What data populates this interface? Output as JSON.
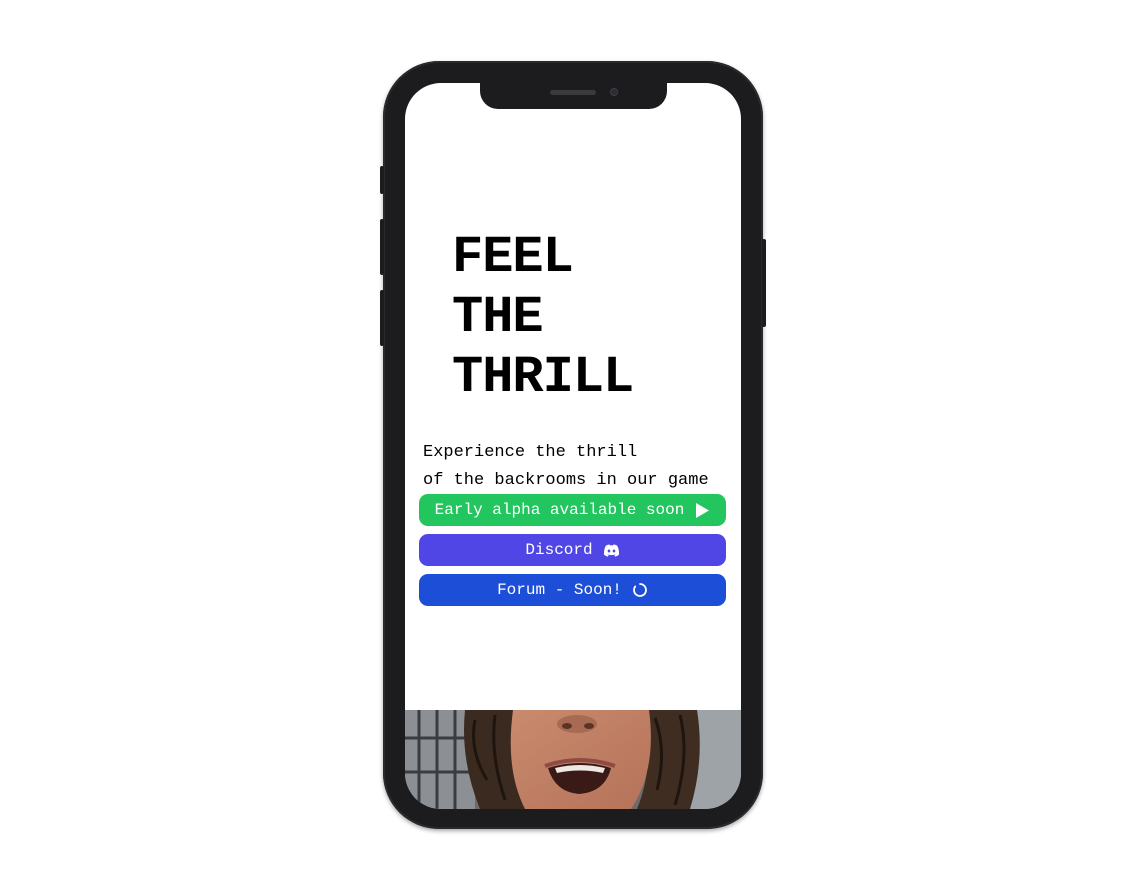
{
  "hero": {
    "headline_lines": [
      "FEEL",
      "THE",
      "THRILL"
    ],
    "tagline_lines": [
      "Experience the thrill",
      "of the backrooms in our game"
    ]
  },
  "buttons": {
    "alpha": {
      "label": "Early alpha available soon",
      "icon": "play-icon",
      "color": "#22c55e"
    },
    "discord": {
      "label": "Discord",
      "icon": "discord-icon",
      "color": "#4f46e5"
    },
    "forum": {
      "label": "Forum - Soon!",
      "icon": "loading-spinner-icon",
      "color": "#1d4ed8"
    }
  },
  "media": {
    "photo": "face-photo"
  }
}
